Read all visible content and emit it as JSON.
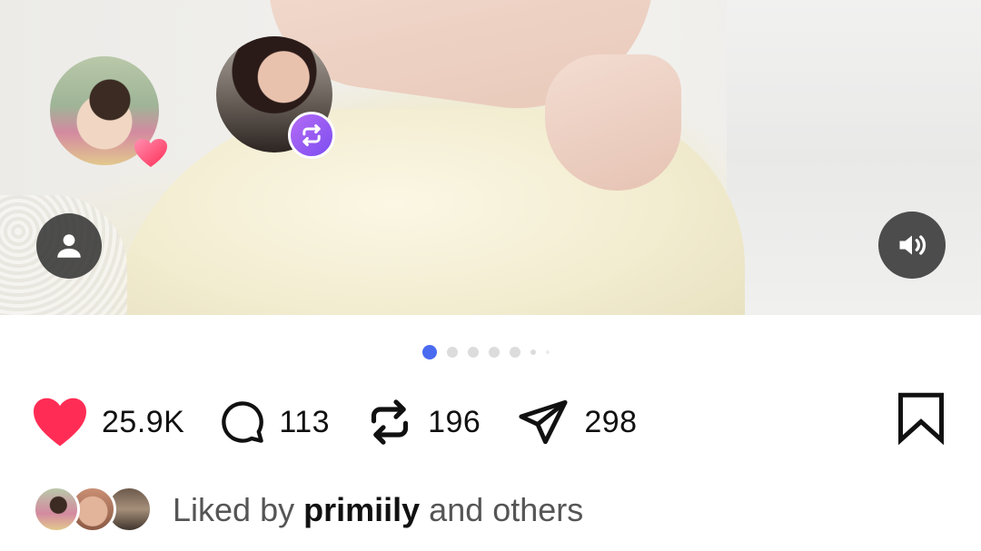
{
  "post": {
    "likes_count": "25.9K",
    "comments_count": "113",
    "reposts_count": "196",
    "shares_count": "298",
    "carousel_index": 1,
    "carousel_total": 6
  },
  "liked_by": {
    "prefix": "Liked by",
    "username": "primiily",
    "suffix": "and others"
  },
  "colors": {
    "like": "#ff2d55",
    "active_dot": "#4a6bf0",
    "repost_badge": "#8a55f2"
  },
  "icons": {
    "like": "heart-icon",
    "comment": "comment-bubble-icon",
    "repost": "repost-icon",
    "share": "send-icon",
    "save": "bookmark-icon",
    "sound": "speaker-icon",
    "tagged": "user-icon"
  }
}
